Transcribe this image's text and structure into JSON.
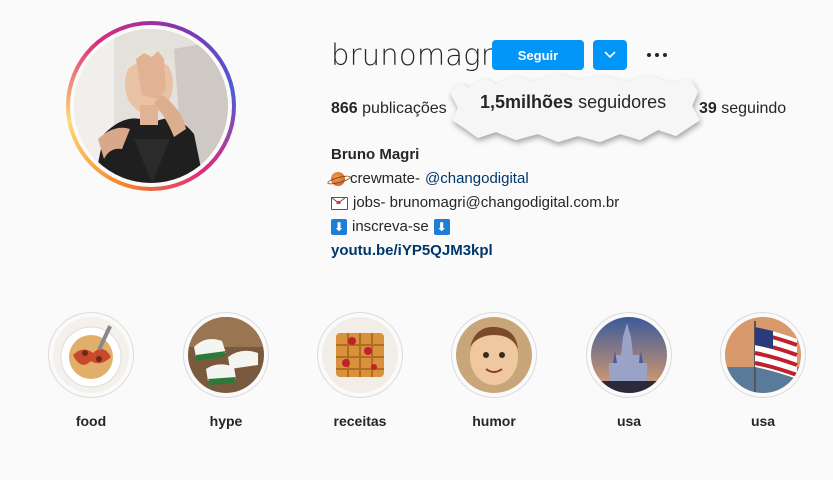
{
  "profile": {
    "username": "brunomagri",
    "follow_label": "Seguir",
    "posts_count": "866",
    "posts_label": "publicações",
    "following_count": "39",
    "following_label": "seguindo",
    "followers_callout_count": "1,5milhões",
    "followers_callout_label": "seguidores"
  },
  "bio": {
    "name": "Bruno Magri",
    "line1_text": "crewmate-",
    "line1_mention": "@changodigital",
    "line2_text": "jobs- brunomagri@changodigital.com.br",
    "line3_text": "inscreva-se",
    "link": "youtu.be/iYP5QJM3kpl",
    "arrow_glyph": "⬇"
  },
  "highlights": [
    {
      "label": "food"
    },
    {
      "label": "hype"
    },
    {
      "label": "receitas"
    },
    {
      "label": "humor"
    },
    {
      "label": "usa"
    },
    {
      "label": "usa"
    }
  ],
  "colors": {
    "accent": "#0095f6",
    "link": "#00376b",
    "text": "#262626",
    "background": "#fafafa"
  },
  "icons": {
    "dropdown": "chevron-down-icon",
    "more": "more-horizontal-icon"
  }
}
